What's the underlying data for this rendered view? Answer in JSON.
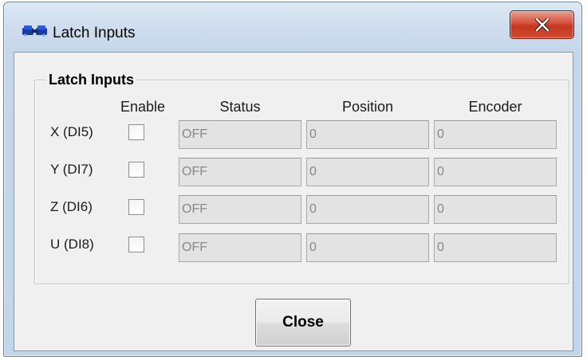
{
  "window": {
    "title": "Latch Inputs",
    "close_glyph": "X",
    "icon": "app-icon"
  },
  "group": {
    "title": "Latch Inputs"
  },
  "columns": {
    "enable": "Enable",
    "status": "Status",
    "position": "Position",
    "encoder": "Encoder"
  },
  "rows": [
    {
      "label": "X (DI5)",
      "enabled": false,
      "status": "OFF",
      "position": "0",
      "encoder": "0"
    },
    {
      "label": "Y (DI7)",
      "enabled": false,
      "status": "OFF",
      "position": "0",
      "encoder": "0"
    },
    {
      "label": "Z (DI6)",
      "enabled": false,
      "status": "OFF",
      "position": "0",
      "encoder": "0"
    },
    {
      "label": "U (DI8)",
      "enabled": false,
      "status": "OFF",
      "position": "0",
      "encoder": "0"
    }
  ],
  "buttons": {
    "close_label": "Close"
  },
  "colors": {
    "titlebar": "#cfdeee",
    "close_x_red": "#c5371f",
    "dialog_face": "#f0f0f0",
    "readonly_field": "#e3e3e3"
  }
}
